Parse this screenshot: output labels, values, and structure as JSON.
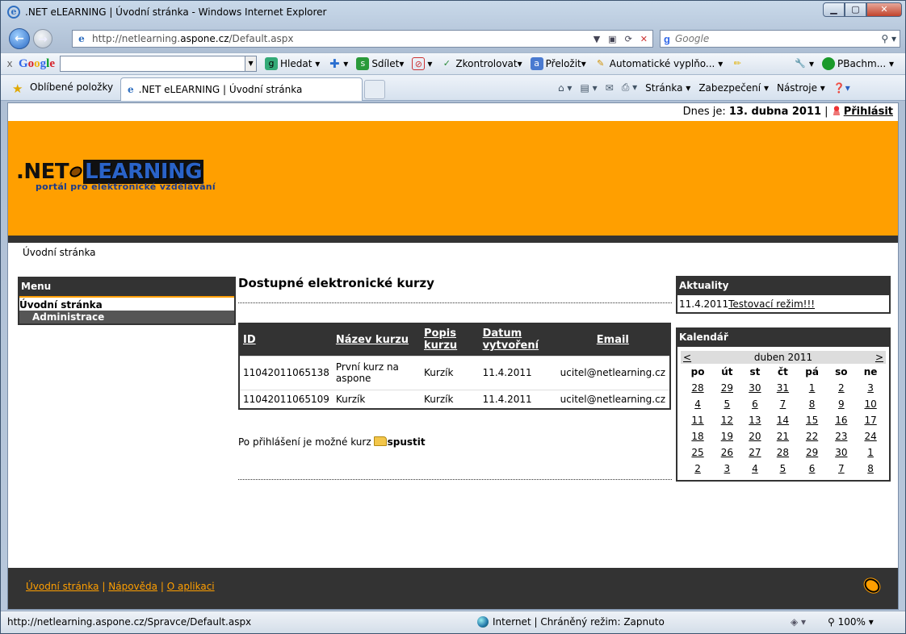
{
  "window": {
    "title": ".NET eLEARNING | Úvodní stránka - Windows Internet Explorer",
    "min": "▁",
    "max": "▢",
    "close": "✕"
  },
  "address": {
    "url_prefix": "http://netlearning.",
    "url_host": "aspone.cz",
    "url_path": "/Default.aspx",
    "search_placeholder": "Google"
  },
  "google_toolbar": {
    "logo": [
      "G",
      "o",
      "o",
      "g",
      "l",
      "e"
    ],
    "search_btn": "Hledat",
    "share_btn": "Sdílet",
    "check_btn": "Zkontrolovat",
    "translate_btn": "Přeložit",
    "autofill_btn": "Automatické vyplňo...",
    "user": "PBachm..."
  },
  "favorites": {
    "label": "Oblíbené položky",
    "tab_title": ".NET eLEARNING | Úvodní stránka",
    "cmd_page": "Stránka",
    "cmd_security": "Zabezpečení",
    "cmd_tools": "Nástroje"
  },
  "page": {
    "date_prefix": "Dnes je:",
    "date": "13. dubna 2011",
    "login": "Přihlásit",
    "logo_net": ".NET",
    "logo_learning": "LEARNING",
    "logo_sub": "portál pro elektronické vzdělávání",
    "breadcrumb": "Úvodní stránka",
    "menu": {
      "title": "Menu",
      "items": [
        "Úvodní stránka",
        "Administrace"
      ]
    },
    "courses": {
      "title": "Dostupné elektronické kurzy",
      "columns": [
        "ID",
        "Název kurzu",
        "Popis kurzu",
        "Datum vytvoření",
        "Email"
      ],
      "rows": [
        [
          "11042011065138",
          "První kurz na aspone",
          "Kurzík",
          "11.4.2011",
          "ucitel@netlearning.cz"
        ],
        [
          "11042011065109",
          "Kurzík",
          "Kurzík",
          "11.4.2011",
          "ucitel@netlearning.cz"
        ]
      ],
      "launch_text": "Po přihlášení je možné kurz",
      "launch_link": "spustit"
    },
    "news": {
      "title": "Aktuality",
      "date": "11.4.2011",
      "item": "Testovací režim!!!"
    },
    "calendar": {
      "title": "Kalendář",
      "prev": "<",
      "next": ">",
      "month": "duben 2011",
      "days": [
        "po",
        "út",
        "st",
        "čt",
        "pá",
        "so",
        "ne"
      ],
      "weeks": [
        [
          "28",
          "29",
          "30",
          "31",
          "1",
          "2",
          "3"
        ],
        [
          "4",
          "5",
          "6",
          "7",
          "8",
          "9",
          "10"
        ],
        [
          "11",
          "12",
          "13",
          "14",
          "15",
          "16",
          "17"
        ],
        [
          "18",
          "19",
          "20",
          "21",
          "22",
          "23",
          "24"
        ],
        [
          "25",
          "26",
          "27",
          "28",
          "29",
          "30",
          "1"
        ],
        [
          "2",
          "3",
          "4",
          "5",
          "6",
          "7",
          "8"
        ]
      ]
    },
    "footer": {
      "links": [
        "Úvodní stránka",
        "Nápověda",
        "O aplikaci"
      ],
      "sep": "|"
    }
  },
  "status": {
    "url": "http://netlearning.aspone.cz/Spravce/Default.aspx",
    "zone": "Internet | Chráněný režim: Zapnuto",
    "zoom": "100%"
  }
}
